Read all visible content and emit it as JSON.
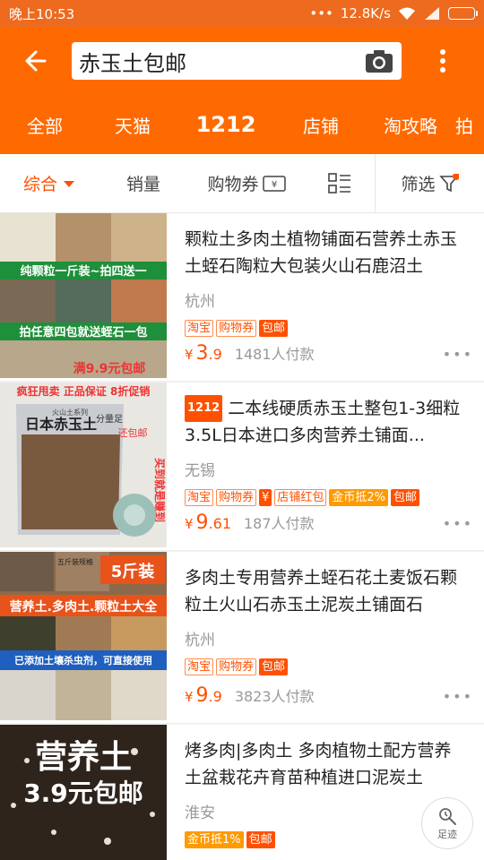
{
  "status": {
    "time": "晚上10:53",
    "speed": "12.8K/s"
  },
  "search": {
    "query": "赤玉土包邮"
  },
  "tabs": [
    "全部",
    "天猫",
    "1212",
    "店铺",
    "淘攻略",
    "拍"
  ],
  "sort": {
    "overall": "综合",
    "sales": "销量",
    "coupon": "购物券",
    "filter": "筛选"
  },
  "colors": {
    "brand": "#ff6a00",
    "price": "#ff5000"
  },
  "items": [
    {
      "title": "颗粒土多肉土植物铺面石营养土赤玉土蛭石陶粒大包装火山石鹿沼土",
      "location": "杭州",
      "tags": [
        "淘宝",
        "购物券",
        "包邮"
      ],
      "price_int": "3",
      "price_dec": ".9",
      "currency": "¥",
      "paid": "1481人付款",
      "img_text": [
        "纯颗粒一斤装~拍四送一",
        "拍任意四包就送蛭石一包",
        "满9.9元包邮"
      ]
    },
    {
      "badge": "1212",
      "title": "二本线硬质赤玉土整包1-3细粒 3.5L日本进口多肉营养土铺面...",
      "location": "无锡",
      "tags": [
        "淘宝",
        "购物券",
        "¥",
        "店铺红包",
        "金币抵2%",
        "包邮"
      ],
      "price_int": "9",
      "price_dec": ".61",
      "currency": "¥",
      "paid": "187人付款",
      "img_text": [
        "疯狂甩卖 正品保证 8折促销",
        "日本赤玉土",
        "火山土系列",
        "分量足",
        "买到就是赚到",
        "还包邮"
      ]
    },
    {
      "title": "多肉土专用营养土蛭石花土麦饭石颗粒土火山石赤玉土泥炭土铺面石",
      "location": "杭州",
      "tags": [
        "淘宝",
        "购物券",
        "包邮"
      ],
      "price_int": "9",
      "price_dec": ".9",
      "currency": "¥",
      "paid": "3823人付款",
      "img_text": [
        "5斤装",
        "营养土.多肉土.颗粒土大全",
        "已添加土壤杀虫剂，可直接使用",
        "五斤装规格"
      ]
    },
    {
      "title": "烤多肉|多肉土 多肉植物土配方营养土盆栽花卉育苗种植进口泥炭土",
      "location": "淮安",
      "tags": [
        "金币抵1%",
        "包邮"
      ],
      "img_text": [
        "营养土",
        "3.9元包邮"
      ]
    }
  ],
  "float": {
    "label": "足迹"
  }
}
